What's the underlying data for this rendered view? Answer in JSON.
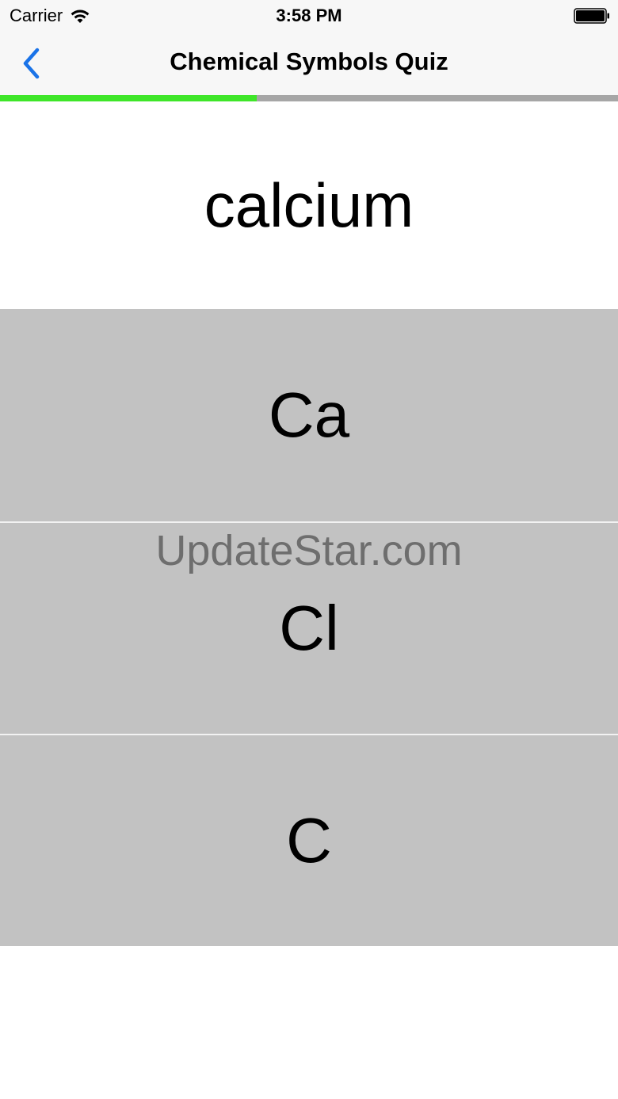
{
  "status_bar": {
    "carrier": "Carrier",
    "wifi_icon": "wifi-icon",
    "time": "3:58 PM",
    "battery_icon": "battery-full-icon"
  },
  "nav_bar": {
    "back_icon": "chevron-left-icon",
    "title": "Chemical Symbols Quiz"
  },
  "progress": {
    "fraction": 0.415,
    "fill_color": "#3fe629",
    "track_color": "#a6a6a6"
  },
  "question": {
    "word": "calcium"
  },
  "answers": [
    {
      "label": "Ca"
    },
    {
      "label": "Cl"
    },
    {
      "label": "C"
    }
  ],
  "colors": {
    "accent": "#1a73e8",
    "option_background": "#c2c2c2"
  },
  "watermark": "UpdateStar.com"
}
